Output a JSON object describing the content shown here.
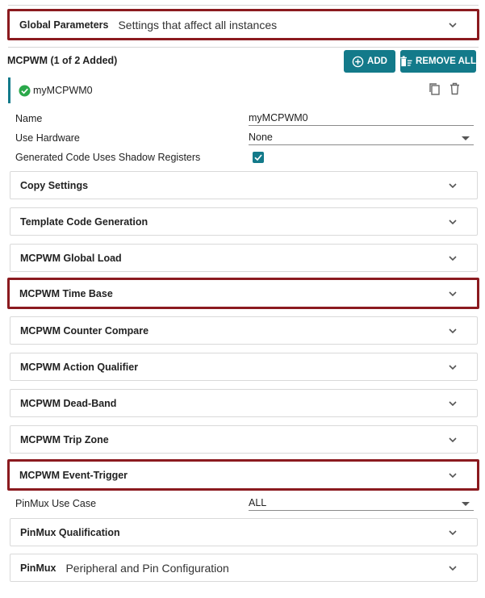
{
  "global_params": {
    "title": "Global Parameters",
    "desc": "Settings that affect all instances"
  },
  "module": {
    "title": "MCPWM (1 of 2 Added)",
    "add_label": "ADD",
    "remove_all_label": "REMOVE ALL",
    "instance_name": "myMCPWM0"
  },
  "fields": {
    "name_label": "Name",
    "name_value": "myMCPWM0",
    "hardware_label": "Use Hardware",
    "hardware_value": "None",
    "shadow_label": "Generated Code Uses Shadow Registers"
  },
  "sections": [
    "Copy Settings",
    "Template Code Generation",
    "MCPWM Global Load",
    "MCPWM Time Base",
    "MCPWM Counter Compare",
    "MCPWM Action Qualifier",
    "MCPWM Dead-Band",
    "MCPWM Trip Zone",
    "MCPWM Event-Trigger"
  ],
  "pinmux": {
    "use_case_label": "PinMux Use Case",
    "use_case_value": "ALL",
    "qualification_title": "PinMux Qualification",
    "title": "PinMux",
    "desc": "Peripheral and Pin Configuration"
  },
  "colors": {
    "accent": "#137a8a",
    "highlight": "#8b1a1f",
    "check": "#2aa84a"
  }
}
